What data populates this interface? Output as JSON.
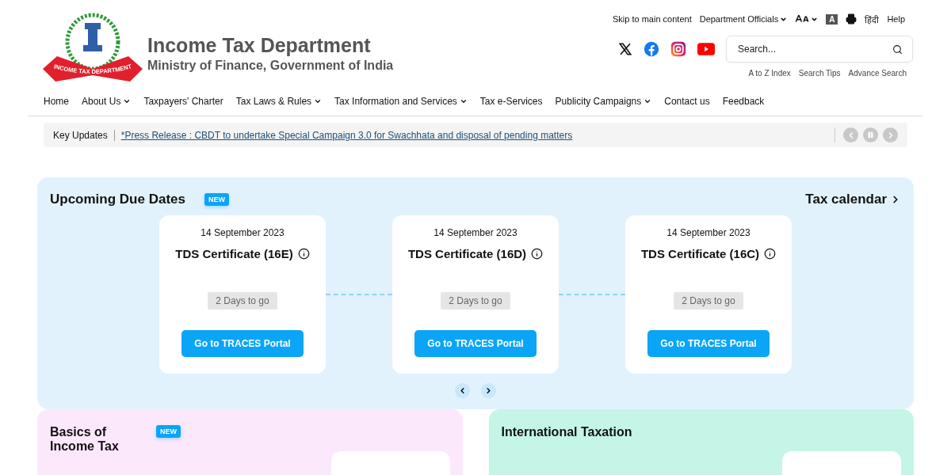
{
  "header": {
    "logo_ribbon": "INCOME TAX DEPARTMENT",
    "title": "Income Tax Department",
    "subtitle": "Ministry of Finance, Government of India"
  },
  "utility_links": [
    {
      "kind": "link",
      "label": "Skip to main content",
      "dropdown": false
    },
    {
      "kind": "link",
      "label": "Department Officials",
      "dropdown": true
    },
    {
      "kind": "text-size",
      "dropdown": true
    },
    {
      "kind": "contrast",
      "label": "A",
      "dropdown": false
    },
    {
      "kind": "print",
      "dropdown": false
    },
    {
      "kind": "link",
      "label": "हिंदी",
      "dropdown": false
    },
    {
      "kind": "link",
      "label": "Help",
      "dropdown": false
    }
  ],
  "social": [
    {
      "kind": "x"
    },
    {
      "kind": "facebook"
    },
    {
      "kind": "instagram"
    },
    {
      "kind": "youtube"
    }
  ],
  "search": {
    "placeholder": "Search..."
  },
  "search_links": [
    "A to Z Index",
    "Search Tips",
    "Advance Search"
  ],
  "nav": [
    {
      "label": "Home",
      "dropdown": false
    },
    {
      "label": "About Us",
      "dropdown": true
    },
    {
      "label": "Taxpayers' Charter",
      "dropdown": false
    },
    {
      "label": "Tax Laws & Rules",
      "dropdown": true
    },
    {
      "label": "Tax Information and Services",
      "dropdown": true
    },
    {
      "label": "Tax e-Services",
      "dropdown": false
    },
    {
      "label": "Publicity Campaigns",
      "dropdown": true
    },
    {
      "label": "Contact us",
      "dropdown": false
    },
    {
      "label": "Feedback",
      "dropdown": false
    }
  ],
  "key_updates": {
    "label": "Key Updates",
    "text": "*Press Release : CBDT to undertake Special Campaign 3.0 for Swachhata and disposal of pending matters"
  },
  "due_dates": {
    "title": "Upcoming Due Dates",
    "badge": "NEW",
    "link": "Tax calendar",
    "cards": [
      {
        "date": "14 September 2023",
        "title": "TDS Certificate (16E)",
        "countdown": "2 Days to go",
        "button": "Go to TRACES Portal"
      },
      {
        "date": "14 September 2023",
        "title": "TDS Certificate (16D)",
        "countdown": "2 Days to go",
        "button": "Go to TRACES Portal"
      },
      {
        "date": "14 September 2023",
        "title": "TDS Certificate (16C)",
        "countdown": "2 Days to go",
        "button": "Go to TRACES Portal"
      }
    ]
  },
  "panels": [
    {
      "title": "Basics of Income Tax",
      "badge": "NEW",
      "color": "#fbe8fb"
    },
    {
      "title": "International Taxation",
      "color": "#c4f5e6"
    }
  ]
}
